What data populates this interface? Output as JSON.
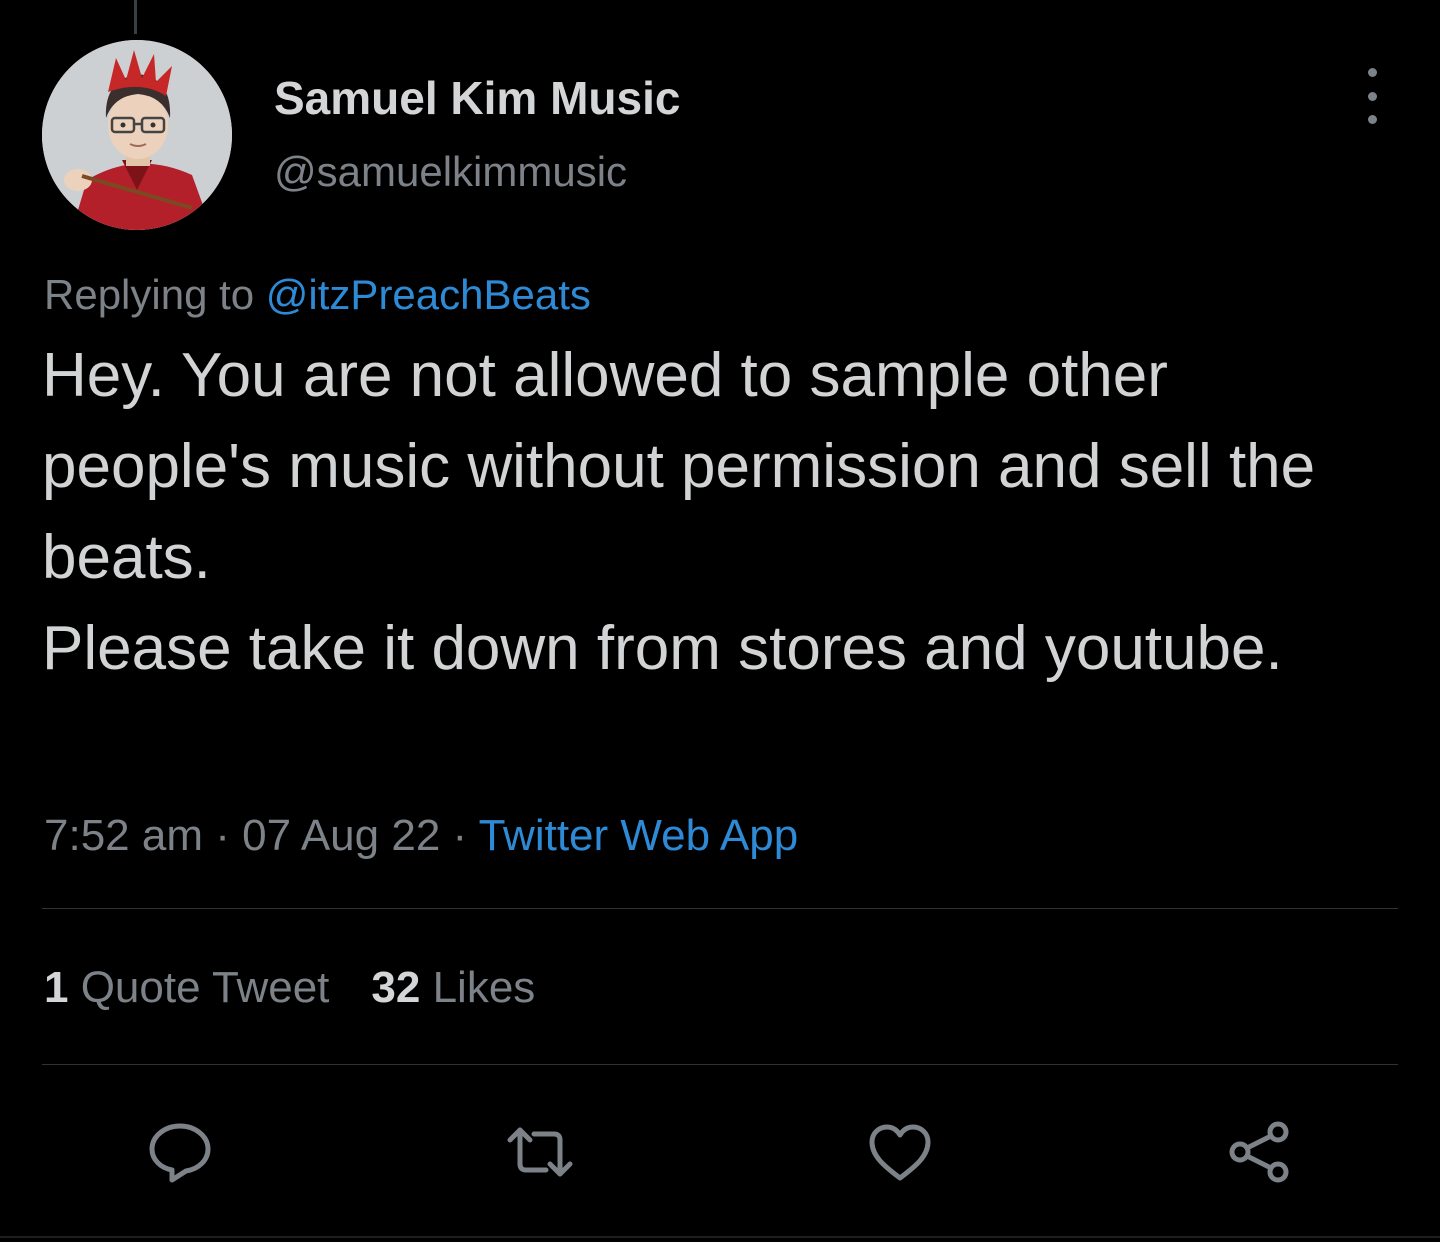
{
  "tweet": {
    "author": {
      "display_name": "Samuel Kim Music",
      "handle": "@samuelkimmusic"
    },
    "reply_prefix": "Replying to ",
    "reply_to": "@itzPreachBeats",
    "text": "Hey. You are not allowed to sample other people's music without permission and sell the beats.\nPlease take it down from stores and youtube.",
    "time": "7:52 am",
    "date": "07 Aug 22",
    "separator": " · ",
    "source": "Twitter Web App"
  },
  "stats": {
    "quote_count": "1",
    "quote_label": " Quote Tweet",
    "like_count": "32",
    "like_label": " Likes"
  },
  "actions": [
    {
      "name": "reply",
      "icon": "speech-bubble-icon"
    },
    {
      "name": "retweet",
      "icon": "retweet-icon"
    },
    {
      "name": "like",
      "icon": "heart-icon"
    },
    {
      "name": "share",
      "icon": "share-icon"
    }
  ],
  "colors": {
    "background": "#000000",
    "text": "#d2d3d4",
    "secondary": "#7c8288",
    "link": "#2f8ad6",
    "divider": "#2f3336"
  }
}
